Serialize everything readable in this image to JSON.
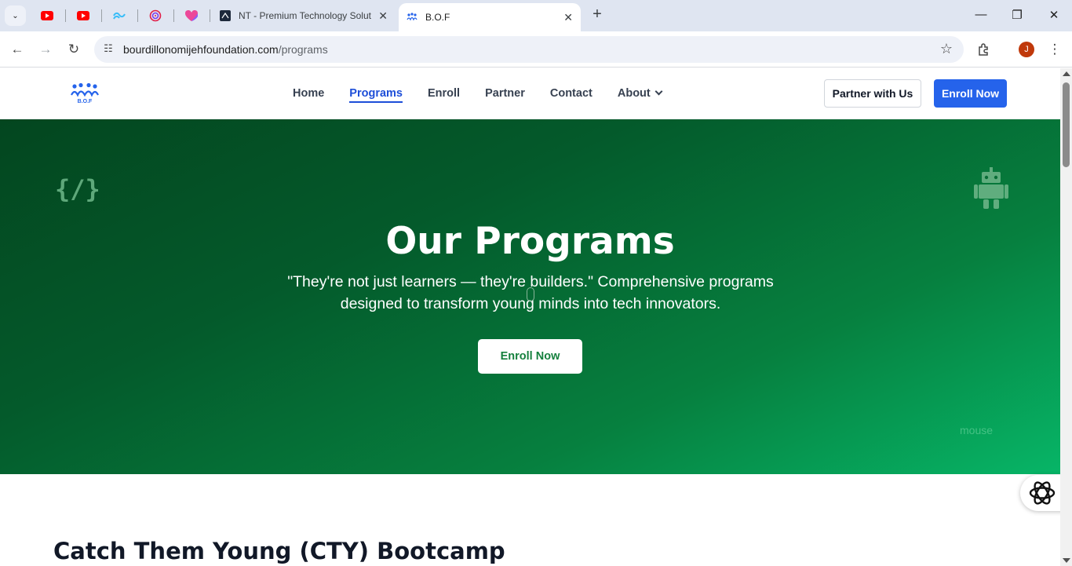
{
  "browser": {
    "tabs": [
      {
        "title": "NT - Premium Technology Solut",
        "icon": "nt-favicon"
      },
      {
        "title": "B.O.F",
        "icon": "bof-favicon",
        "active": true
      }
    ],
    "pinned_icons": [
      "youtube-icon",
      "youtube-icon",
      "tailwind-icon",
      "spiral-icon",
      "bookmark-heart-icon"
    ],
    "url_domain": "bourdillonomijehfoundation.com",
    "url_path": "/programs",
    "profile_initial": "J"
  },
  "nav": {
    "logo_text": "B.O.F",
    "links": [
      "Home",
      "Programs",
      "Enroll",
      "Partner",
      "Contact",
      "About"
    ],
    "active_link": "Programs",
    "partner_button": "Partner with Us",
    "enroll_button": "Enroll Now"
  },
  "hero": {
    "code_icon": "{/}",
    "title": "Our Programs",
    "subtitle": "\"They're not just learners — they're builders.\" Comprehensive programs designed to transform young minds into tech innovators.",
    "button": "Enroll Now",
    "broken_image_alt": "mouse"
  },
  "section": {
    "title": "Catch Them Young (CTY) Bootcamp"
  },
  "colors": {
    "primary": "#2563eb",
    "hero_start": "#03461f",
    "hero_end": "#07b567",
    "hero_button_text": "#15803d"
  }
}
